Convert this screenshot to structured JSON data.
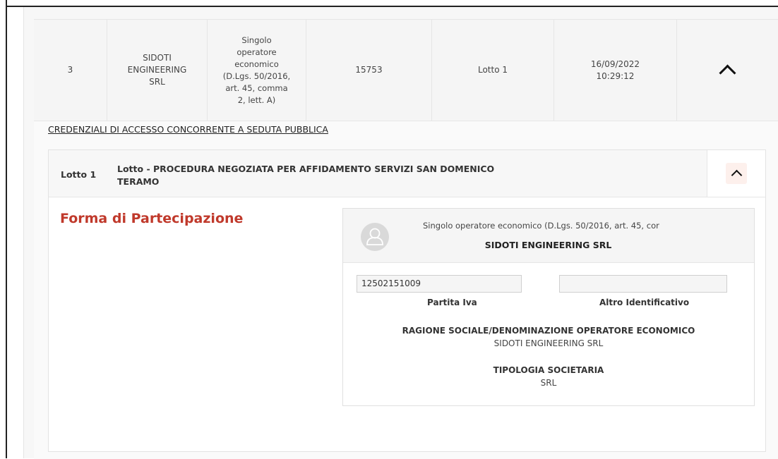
{
  "row": {
    "number": "3",
    "operator_name": "SIDOTI ENGINEERING SRL",
    "forma": "Singolo operatore economico (D.Lgs. 50/2016, art. 45, comma 2, lett. A)",
    "code": "15753",
    "lotto": "Lotto 1",
    "date": "16/09/2022",
    "time": "10:29:12"
  },
  "credentials_link": "CREDENZIALI DI ACCESSO CONCORRENTE A SEDUTA PUBBLICA",
  "lotto_section": {
    "label": "Lotto 1",
    "title": "Lotto - PROCEDURA NEGOZIATA PER AFFIDAMENTO SERVIZI SAN DOMENICO TERAMO"
  },
  "forma_title": "Forma di Partecipazione",
  "card": {
    "subtitle": "Singolo operatore economico (D.Lgs. 50/2016, art. 45, cor",
    "name": "SIDOTI ENGINEERING SRL",
    "partita_iva_value": "12502151009",
    "partita_iva_label": "Partita Iva",
    "altro_value": "",
    "altro_label": "Altro Identificativo",
    "ragione_label": "RAGIONE SOCIALE/DENOMINAZIONE OPERATORE ECONOMICO",
    "ragione_value": "SIDOTI ENGINEERING SRL",
    "tipologia_label": "TIPOLOGIA SOCIETARIA",
    "tipologia_value": "SRL"
  },
  "icons": {
    "row_toggle": "chevron-up-icon",
    "lotto_toggle": "chevron-up-icon",
    "avatar": "user-avatar-icon"
  },
  "colors": {
    "accent_red": "#c0392b",
    "toggle_chip": "#fdf0ec"
  }
}
